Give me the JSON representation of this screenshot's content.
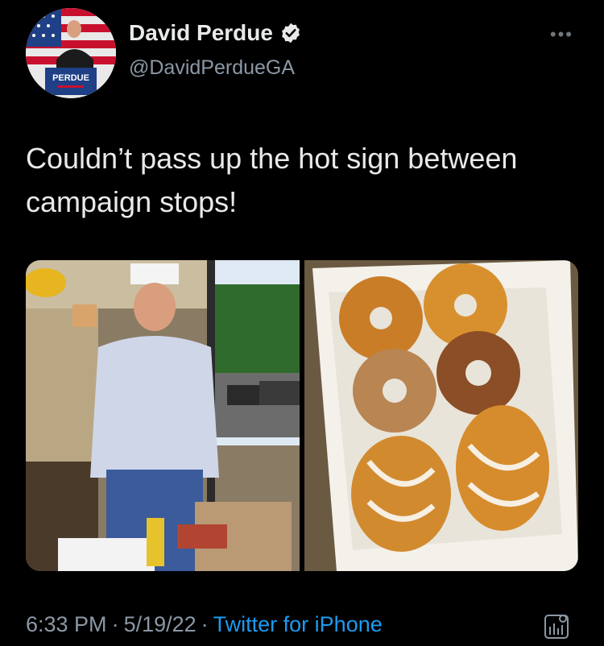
{
  "author": {
    "name": "David Perdue",
    "handle": "@DavidPerdueGA",
    "avatar_text": "PERDUE"
  },
  "tweet": {
    "text": "Couldn’t pass up the hot sign between campaign stops!"
  },
  "meta": {
    "time": "6:33 PM",
    "separator": "·",
    "date": "5/19/22",
    "source": "Twitter for iPhone"
  },
  "icons": {
    "verified": "verified-badge-icon",
    "more": "more-options-icon",
    "analytics": "analytics-icon"
  },
  "colors": {
    "background": "#000000",
    "text": "#e7e9ea",
    "secondary": "#8b98a5",
    "link": "#1d9bf0"
  }
}
